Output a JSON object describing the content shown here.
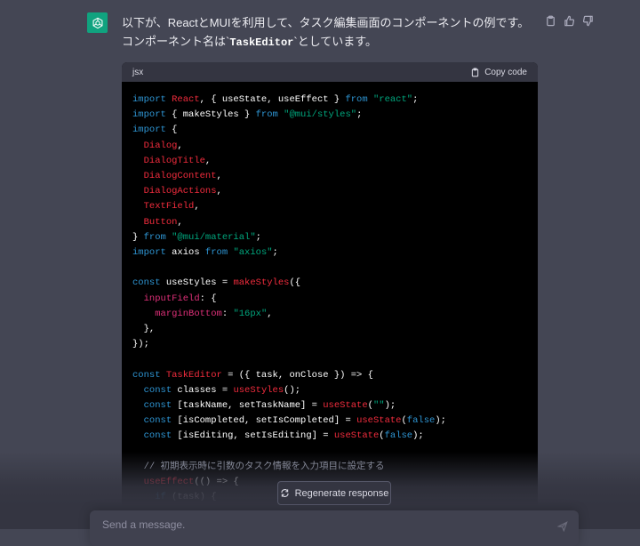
{
  "message": {
    "text_before": "以下が、ReactとMUIを利用して、タスク編集画面のコンポーネントの例です。コンポーネント名は`",
    "inline_code": "TaskEditor",
    "text_after": "`としています。"
  },
  "actions": {
    "copy": "clipboard-icon",
    "thumbs_up": "thumbs-up-icon",
    "thumbs_down": "thumbs-down-icon"
  },
  "code_block": {
    "language": "jsx",
    "copy_label": "Copy code",
    "lines": [
      [
        [
          "kw",
          "import "
        ],
        [
          "fn",
          "React"
        ],
        [
          "pl",
          ", { useState, useEffect } "
        ],
        [
          "kw",
          "from "
        ],
        [
          "st",
          "\"react\""
        ],
        [
          "pl",
          ";"
        ]
      ],
      [
        [
          "kw",
          "import "
        ],
        [
          "pl",
          "{ makeStyles } "
        ],
        [
          "kw",
          "from "
        ],
        [
          "st",
          "\"@mui/styles\""
        ],
        [
          "pl",
          ";"
        ]
      ],
      [
        [
          "kw",
          "import "
        ],
        [
          "pl",
          "{"
        ]
      ],
      [
        [
          "pl",
          "  "
        ],
        [
          "fn",
          "Dialog"
        ],
        [
          "pl",
          ","
        ]
      ],
      [
        [
          "pl",
          "  "
        ],
        [
          "fn",
          "DialogTitle"
        ],
        [
          "pl",
          ","
        ]
      ],
      [
        [
          "pl",
          "  "
        ],
        [
          "fn",
          "DialogContent"
        ],
        [
          "pl",
          ","
        ]
      ],
      [
        [
          "pl",
          "  "
        ],
        [
          "fn",
          "DialogActions"
        ],
        [
          "pl",
          ","
        ]
      ],
      [
        [
          "pl",
          "  "
        ],
        [
          "fn",
          "TextField"
        ],
        [
          "pl",
          ","
        ]
      ],
      [
        [
          "pl",
          "  "
        ],
        [
          "fn",
          "Button"
        ],
        [
          "pl",
          ","
        ]
      ],
      [
        [
          "pl",
          "} "
        ],
        [
          "kw",
          "from "
        ],
        [
          "st",
          "\"@mui/material\""
        ],
        [
          "pl",
          ";"
        ]
      ],
      [
        [
          "kw",
          "import "
        ],
        [
          "pl",
          "axios "
        ],
        [
          "kw",
          "from "
        ],
        [
          "st",
          "\"axios\""
        ],
        [
          "pl",
          ";"
        ]
      ],
      [
        [
          "pl",
          ""
        ]
      ],
      [
        [
          "kw",
          "const "
        ],
        [
          "pl",
          "useStyles = "
        ],
        [
          "fn",
          "makeStyles"
        ],
        [
          "pl",
          "({"
        ]
      ],
      [
        [
          "pl",
          "  "
        ],
        [
          "pr",
          "inputField"
        ],
        [
          "pl",
          ": {"
        ]
      ],
      [
        [
          "pl",
          "    "
        ],
        [
          "pr",
          "marginBottom"
        ],
        [
          "pl",
          ": "
        ],
        [
          "st",
          "\"16px\""
        ],
        [
          "pl",
          ","
        ]
      ],
      [
        [
          "pl",
          "  },"
        ]
      ],
      [
        [
          "pl",
          "});"
        ]
      ],
      [
        [
          "pl",
          ""
        ]
      ],
      [
        [
          "kw",
          "const "
        ],
        [
          "fn",
          "TaskEditor"
        ],
        [
          "pl",
          " = ({ task, onClose }) => {"
        ]
      ],
      [
        [
          "pl",
          "  "
        ],
        [
          "kw",
          "const "
        ],
        [
          "pl",
          "classes = "
        ],
        [
          "fn",
          "useStyles"
        ],
        [
          "pl",
          "();"
        ]
      ],
      [
        [
          "pl",
          "  "
        ],
        [
          "kw",
          "const "
        ],
        [
          "pl",
          "[taskName, setTaskName] = "
        ],
        [
          "fn",
          "useState"
        ],
        [
          "pl",
          "("
        ],
        [
          "st",
          "\"\""
        ],
        [
          "pl",
          ");"
        ]
      ],
      [
        [
          "pl",
          "  "
        ],
        [
          "kw",
          "const "
        ],
        [
          "pl",
          "[isCompleted, setIsCompleted] = "
        ],
        [
          "fn",
          "useState"
        ],
        [
          "pl",
          "("
        ],
        [
          "kw",
          "false"
        ],
        [
          "pl",
          ");"
        ]
      ],
      [
        [
          "pl",
          "  "
        ],
        [
          "kw",
          "const "
        ],
        [
          "pl",
          "[isEditing, setIsEditing] = "
        ],
        [
          "fn",
          "useState"
        ],
        [
          "pl",
          "("
        ],
        [
          "kw",
          "false"
        ],
        [
          "pl",
          ");"
        ]
      ],
      [
        [
          "pl",
          ""
        ]
      ],
      [
        [
          "pl",
          "  "
        ],
        [
          "cm",
          "// 初期表示時に引数のタスク情報を入力項目に設定する"
        ]
      ],
      [
        [
          "pl",
          "  "
        ],
        [
          "fn",
          "useEffect"
        ],
        [
          "pl",
          "(() => {"
        ]
      ],
      [
        [
          "pl",
          "    "
        ],
        [
          "kw",
          "if "
        ],
        [
          "pl",
          "(task) {"
        ]
      ]
    ]
  },
  "regenerate_label": "Regenerate response",
  "composer": {
    "placeholder": "Send a message.",
    "send_icon": "send-icon"
  }
}
